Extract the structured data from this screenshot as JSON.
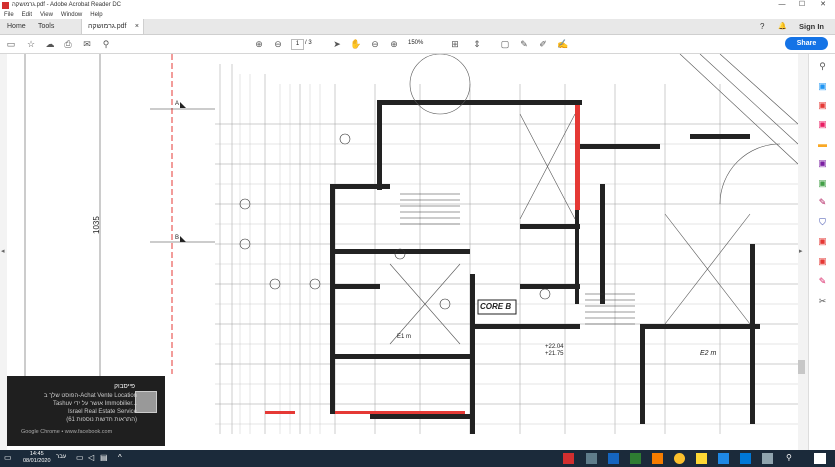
{
  "window": {
    "title": "גרמושקה.pdf - Adobe Acrobat Reader DC",
    "controls": [
      "—",
      "☐",
      "✕"
    ]
  },
  "menu": [
    "File",
    "Edit",
    "View",
    "Window",
    "Help"
  ],
  "tabs": {
    "home": "Home",
    "tools": "Tools",
    "doc": "גרמושקה.pdf",
    "close": "×"
  },
  "topright": {
    "help": "?",
    "bell": "🔔",
    "signin": "Sign In"
  },
  "toolbar": {
    "page_current": "1",
    "page_total": "/ 3",
    "zoom": "150%",
    "share": "Share"
  },
  "drawing": {
    "label_1035": "1035",
    "label_coreb": "CORE B",
    "label_level1": "+22.04",
    "label_level2": "+21.75",
    "label_sector": "E2 m",
    "label_e1": "E1 m",
    "label_a": "A",
    "label_b": "B"
  },
  "notification": {
    "title": "פייסבוק",
    "line1": "הפוסט שלך ב-Achat Vente Location",
    "line2": "Tashuv אושר על ידי Immobilier...",
    "line3": "Israel Real Estate Service",
    "line4": "(61 התראות חדשות נוספות)",
    "source": "Google Chrome • www.facebook.com"
  },
  "taskbar": {
    "time": "14:45",
    "date": "08/01/2020",
    "lang": "עבר"
  },
  "colors": {
    "accent": "#1473e6",
    "redline": "#e53935",
    "taskbar": "#1b2a3a"
  }
}
